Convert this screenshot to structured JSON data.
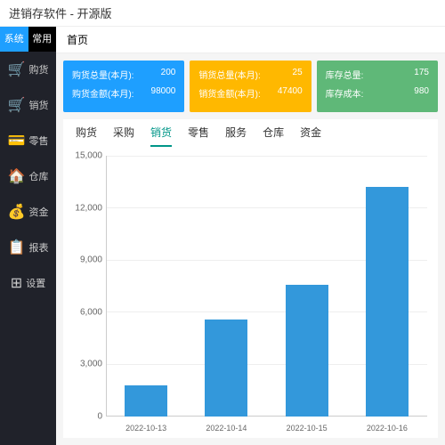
{
  "app_title": "进销存软件 - 开源版",
  "side_tabs": {
    "active": "系统",
    "inactive": "常用"
  },
  "sidebar": [
    {
      "icon": "🛒",
      "label": "购货"
    },
    {
      "icon": "🛒",
      "label": "销货"
    },
    {
      "icon": "💳",
      "label": "零售"
    },
    {
      "icon": "🏠",
      "label": "仓库"
    },
    {
      "icon": "💰",
      "label": "资金"
    },
    {
      "icon": "📋",
      "label": "报表"
    },
    {
      "icon": "⊞",
      "label": "设置"
    }
  ],
  "breadcrumb": "首页",
  "cards": [
    {
      "class": "blue",
      "l1_label": "购货总量(本月):",
      "l1_val": "200",
      "l2_label": "购货金额(本月):",
      "l2_val": "98000"
    },
    {
      "class": "orange",
      "l1_label": "销货总量(本月):",
      "l1_val": "25",
      "l2_label": "销货金额(本月):",
      "l2_val": "47400"
    },
    {
      "class": "green",
      "l1_label": "库存总量:",
      "l1_val": "175",
      "l2_label": "库存成本:",
      "l2_val": "980"
    }
  ],
  "tabs": [
    "购货",
    "采购",
    "销货",
    "零售",
    "服务",
    "仓库",
    "资金"
  ],
  "active_tab": 2,
  "chart_data": {
    "type": "bar",
    "categories": [
      "2022-10-13",
      "2022-10-14",
      "2022-10-15",
      "2022-10-16"
    ],
    "values": [
      1800,
      5600,
      7600,
      13200
    ],
    "title": "",
    "xlabel": "",
    "ylabel": "",
    "ylim": [
      0,
      15000
    ],
    "yticks": [
      0,
      3000,
      6000,
      9000,
      12000,
      15000
    ]
  }
}
